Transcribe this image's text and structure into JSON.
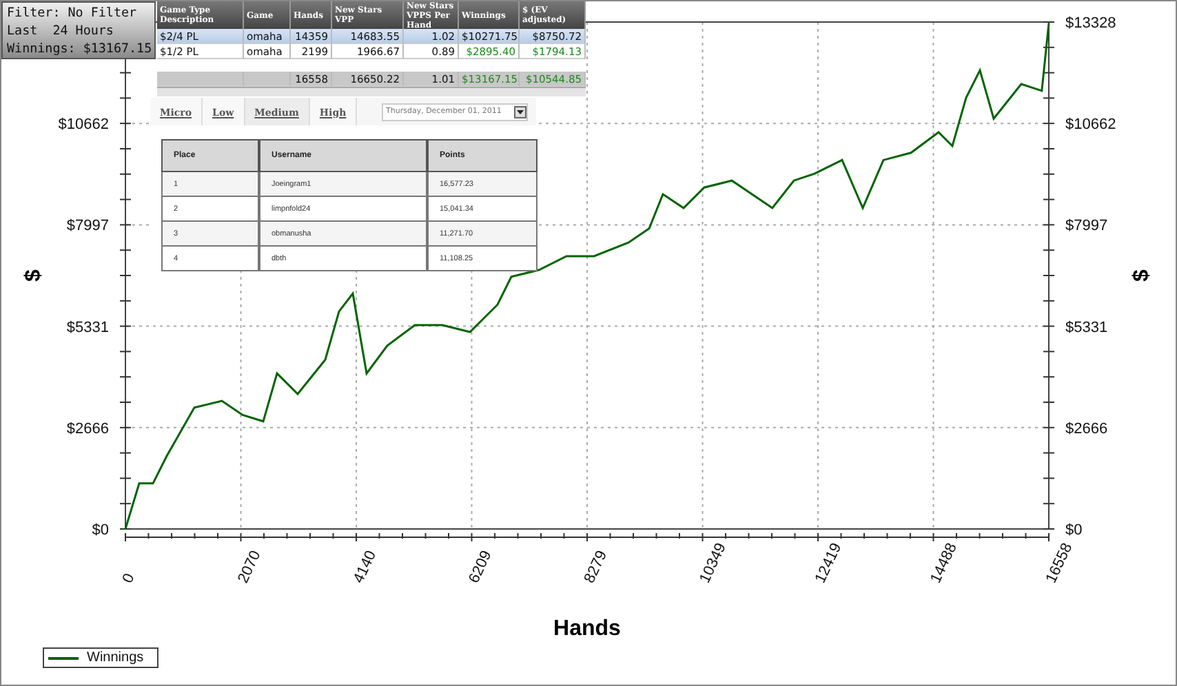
{
  "filter_box": {
    "lines": [
      "Filter: No Filter",
      "Last  24 Hours",
      "Winnings: $13167.15"
    ]
  },
  "game_table": {
    "columns": [
      "Game Type Description",
      "Game",
      "Hands",
      "New Stars VPP",
      "New Stars VPPS Per Hand",
      "Winnings",
      "$ (EV adjusted)"
    ],
    "rows": [
      {
        "selected": true,
        "cells": [
          "$2/4 PL",
          "omaha",
          "14359",
          "14683.55",
          "1.02",
          "$10271.75",
          "$8750.72"
        ]
      },
      {
        "selected": false,
        "cells": [
          "$1/2 PL",
          "omaha",
          "2199",
          "1966.67",
          "0.89",
          "$2895.40",
          "$1794.13"
        ]
      }
    ],
    "totals": [
      "16558",
      "16650.22",
      "1.01",
      "$13167.15",
      "$10544.85"
    ]
  },
  "stake_tabs": [
    {
      "label": "Micro",
      "selected": false
    },
    {
      "label": "Low",
      "selected": false
    },
    {
      "label": "Medium",
      "selected": true
    },
    {
      "label": "High",
      "selected": false
    }
  ],
  "date_picker": {
    "value": "Thursday, December 01, 2011"
  },
  "leaderboard": {
    "columns": [
      "Place",
      "Username",
      "Points"
    ],
    "rows": [
      [
        "1",
        "Joeingram1",
        "16,577.23"
      ],
      [
        "2",
        "limpnfold24",
        "15,041.34"
      ],
      [
        "3",
        "obmanusha",
        "11,271.70"
      ],
      [
        "4",
        "dbth",
        "11,108.25"
      ]
    ]
  },
  "chart": {
    "chart_data": {
      "type": "line",
      "grid": true,
      "xlabel": "Hands",
      "ylabel": "$",
      "xlim": [
        0,
        16558
      ],
      "ylim": [
        0,
        13328
      ],
      "xticks": [
        0,
        2070,
        4140,
        6209,
        8279,
        10349,
        12419,
        14488,
        16558
      ],
      "yticks": [
        {
          "value": 0,
          "label": "$0"
        },
        {
          "value": 2666,
          "label": "$2666"
        },
        {
          "value": 5331,
          "label": "$5331"
        },
        {
          "value": 7997,
          "label": "$7997"
        },
        {
          "value": 10662,
          "label": "$10662"
        },
        {
          "value": 13328,
          "label": "$13328"
        }
      ],
      "x": [
        0,
        247,
        494,
        741,
        1236,
        1730,
        2101,
        2471,
        2718,
        3089,
        3584,
        3831,
        4078,
        4325,
        4696,
        5190,
        5684,
        6178,
        6673,
        6920,
        7414,
        7908,
        8403,
        9020,
        9391,
        9638,
        10009,
        10380,
        10874,
        11600,
        11986,
        12357,
        12851,
        13221,
        13592,
        14087,
        14581,
        14828,
        15075,
        15322,
        15569,
        16063,
        16433,
        16558
      ],
      "series": [
        {
          "name": "Winnings",
          "color": "#006400",
          "values": [
            0,
            1200,
            1200,
            1920,
            3190,
            3370,
            3000,
            2830,
            4090,
            3550,
            4450,
            5720,
            6190,
            4090,
            4820,
            5360,
            5360,
            5180,
            5900,
            6630,
            6810,
            7170,
            7170,
            7530,
            7900,
            8800,
            8440,
            8980,
            9160,
            8440,
            9160,
            9340,
            9700,
            8440,
            9700,
            9890,
            10430,
            10070,
            11340,
            12060,
            10790,
            11700,
            11520,
            13300
          ]
        }
      ]
    }
  }
}
